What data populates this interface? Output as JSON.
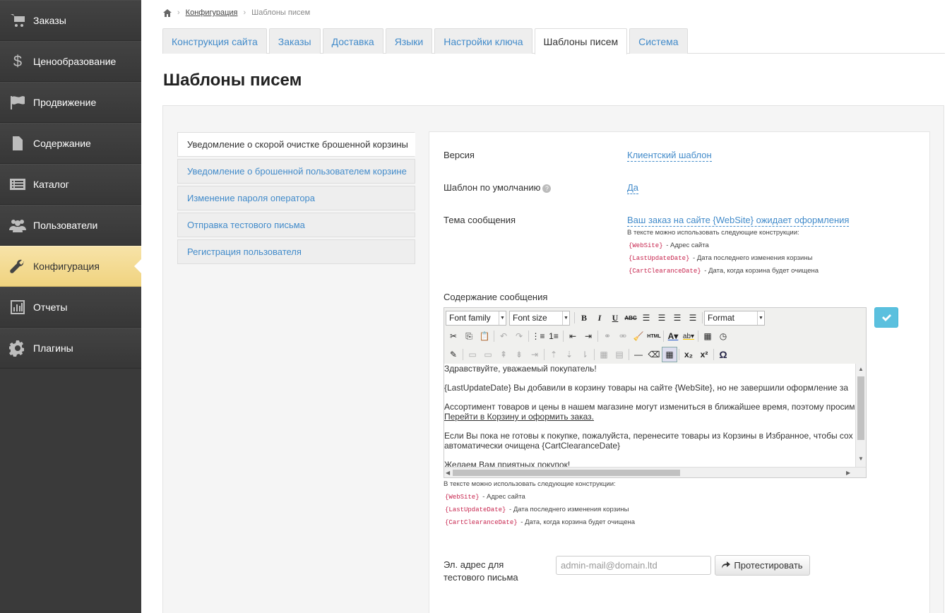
{
  "sidebar": {
    "items": [
      {
        "label": "Заказы",
        "icon": "cart-icon"
      },
      {
        "label": "Ценообразование",
        "icon": "dollar-icon"
      },
      {
        "label": "Продвижение",
        "icon": "flag-icon"
      },
      {
        "label": "Содержание",
        "icon": "document-icon"
      },
      {
        "label": "Каталог",
        "icon": "catalog-icon"
      },
      {
        "label": "Пользователи",
        "icon": "users-icon"
      },
      {
        "label": "Конфигурация",
        "icon": "wrench-icon",
        "active": true
      },
      {
        "label": "Отчеты",
        "icon": "chart-icon"
      },
      {
        "label": "Плагины",
        "icon": "gear-icon"
      }
    ]
  },
  "breadcrumb": {
    "link": "Конфигурация",
    "current": "Шаблоны писем"
  },
  "tabs": [
    {
      "label": "Конструкция сайта"
    },
    {
      "label": "Заказы"
    },
    {
      "label": "Доставка"
    },
    {
      "label": "Языки"
    },
    {
      "label": "Настройки ключа"
    },
    {
      "label": "Шаблоны писем",
      "active": true
    },
    {
      "label": "Система"
    }
  ],
  "page_title": "Шаблоны писем",
  "templates": [
    {
      "label": "Уведомление о скорой очистке брошенной корзины",
      "active": true
    },
    {
      "label": "Уведомление о брошенной пользователем корзине"
    },
    {
      "label": "Изменение пароля оператора"
    },
    {
      "label": "Отправка тестового письма"
    },
    {
      "label": "Регистрация пользователя"
    }
  ],
  "form": {
    "version_label": "Версия",
    "version_value": "Клиентский шаблон",
    "default_label": "Шаблон по умолчанию",
    "default_help": "?",
    "default_value": "Да",
    "subject_label": "Тема сообщения",
    "subject_value": "Ваш заказ на сайте {WebSite} ожидает оформления",
    "content_label": "Содержание сообщения",
    "email_label_1": "Эл. адрес для",
    "email_label_2": "тестового письма",
    "email_placeholder": "admin-mail@domain.ltd",
    "test_button": "Протестировать"
  },
  "hints": {
    "intro": "В тексте можно использовать следующие конструкции:",
    "items": [
      {
        "code": "{WebSite}",
        "desc": " - Адрес сайта"
      },
      {
        "code": "{LastUpdateDate}",
        "desc": " - Дата последнего изменения корзины"
      },
      {
        "code": "{CartClearanceDate}",
        "desc": " - Дата, когда корзина будет очищена"
      }
    ]
  },
  "editor": {
    "font_family": "Font family",
    "font_size": "Font size",
    "format": "Format",
    "lines": [
      "Здравствуйте, уважаемый покупатель!",
      "{LastUpdateDate} Вы добавили в корзину товары на сайте {WebSite}, но не завершили оформление за",
      "Ассортимент товаров и цены в нашем магазине могут измениться в ближайшее время, поэтому просим",
      "Перейти в Корзину и оформить заказ.",
      "Если Вы пока не готовы к покупке, пожалуйста, перенесите товары из Корзины в Избранное, чтобы сох",
      "автоматически очищена {CartClearanceDate}",
      "Желаем Вам приятных покупок!"
    ]
  }
}
